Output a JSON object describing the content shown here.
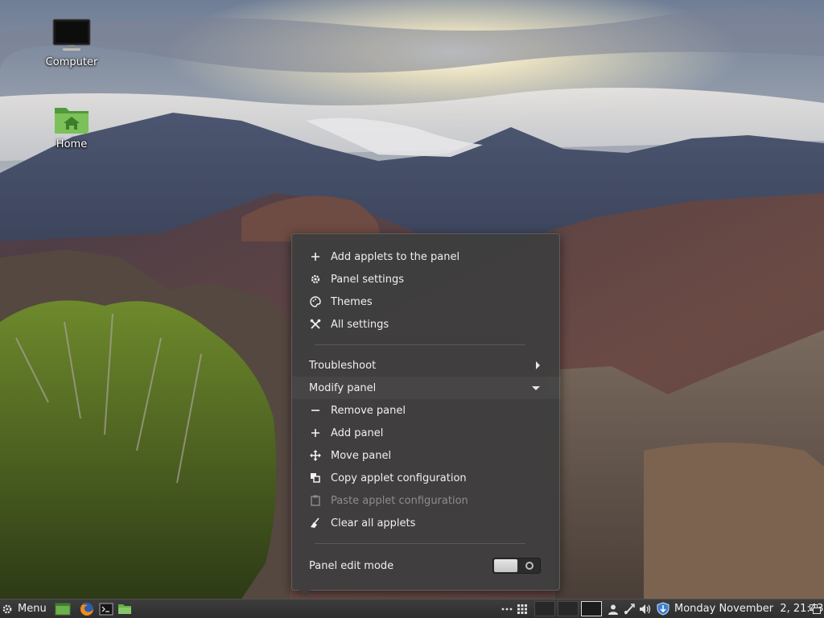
{
  "desktop": {
    "icons": [
      {
        "label": "Computer",
        "icon": "monitor-icon"
      },
      {
        "label": "Home",
        "icon": "home-folder-icon"
      }
    ]
  },
  "context_menu": {
    "items": [
      {
        "label": "Add applets to the panel",
        "icon": "plus-icon"
      },
      {
        "label": "Panel settings",
        "icon": "gear-icon"
      },
      {
        "label": "Themes",
        "icon": "palette-icon"
      },
      {
        "label": "All settings",
        "icon": "tools-icon"
      }
    ],
    "troubleshoot": {
      "label": "Troubleshoot"
    },
    "modify_panel": {
      "label": "Modify panel"
    },
    "modify_items": [
      {
        "label": "Remove panel",
        "icon": "minus-icon",
        "enabled": true
      },
      {
        "label": "Add panel",
        "icon": "plus-icon",
        "enabled": true
      },
      {
        "label": "Move panel",
        "icon": "move-arrows-icon",
        "enabled": true
      },
      {
        "label": "Copy applet configuration",
        "icon": "copy-icon",
        "enabled": true
      },
      {
        "label": "Paste applet configuration",
        "icon": "paste-icon",
        "enabled": false
      },
      {
        "label": "Clear all applets",
        "icon": "broom-icon",
        "enabled": true
      }
    ],
    "edit_mode": {
      "label": "Panel edit mode",
      "value": false
    }
  },
  "panel": {
    "menu_label": "Menu",
    "launchers": [
      "show-desktop-icon",
      "firefox-icon",
      "terminal-icon",
      "files-icon"
    ],
    "tray": [
      "overflow-dots-icon",
      "grid-icon",
      "user-icon",
      "network-icon",
      "volume-icon",
      "shield-update-icon",
      "windows-list-icon"
    ],
    "workspaces": [
      false,
      false,
      true
    ],
    "clock": "Monday November  2, 21:43"
  },
  "colors": {
    "menu_bg": "#3e3e3e",
    "panel_bg": "#333333",
    "folder_green": "#6ab04c"
  }
}
